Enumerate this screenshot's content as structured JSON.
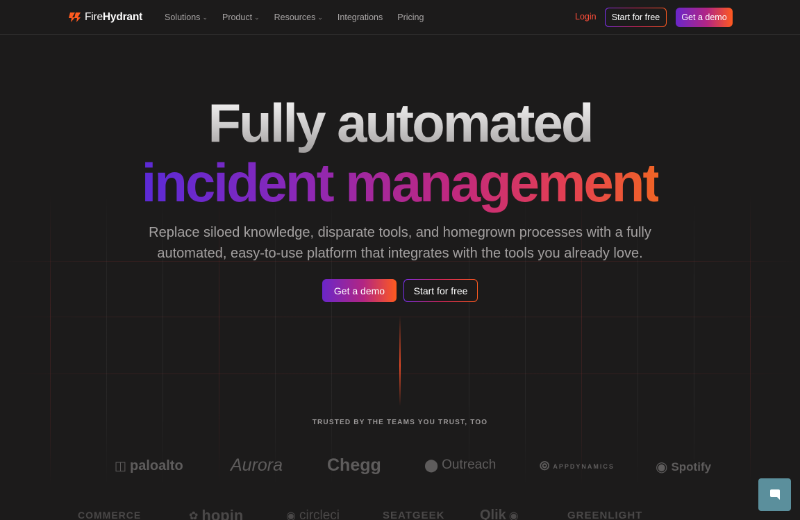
{
  "nav": {
    "brand_light": "Fire",
    "brand_bold": "Hydrant",
    "links": [
      {
        "label": "Solutions",
        "has_dropdown": true
      },
      {
        "label": "Product",
        "has_dropdown": true
      },
      {
        "label": "Resources",
        "has_dropdown": true
      },
      {
        "label": "Integrations",
        "has_dropdown": false
      },
      {
        "label": "Pricing",
        "has_dropdown": false
      }
    ],
    "login": "Login",
    "start_free": "Start for free",
    "get_demo": "Get a demo"
  },
  "hero": {
    "title_line1": "Fully automated",
    "title_line2": "incident management",
    "subtitle": "Replace siloed knowledge, disparate tools, and homegrown processes with a fully automated, easy-to-use platform that integrates with the tools you already love.",
    "cta_primary": "Get a demo",
    "cta_secondary": "Start for free"
  },
  "trusted": {
    "heading": "TRUSTED BY THE TEAMS YOU TRUST, TOO",
    "row1": [
      "paloalto",
      "Aurora",
      "Chegg",
      "Outreach",
      "APPDYNAMICS",
      "Spotify"
    ],
    "row2": [
      "COMMERCE",
      "hopin",
      "circleci",
      "SEATGEEK",
      "Qlik",
      "GREENLIGHT"
    ]
  },
  "colors": {
    "accent": "#ff4e3a",
    "gradient_start": "#6a26c9",
    "gradient_end": "#ff5a1f",
    "background": "#1c1b1b",
    "chat": "#5b8f9c"
  },
  "icons": {
    "logo": "firehydrant-logo-icon",
    "dropdown": "chevron-down-icon",
    "chat": "chat-bubble-icon"
  }
}
